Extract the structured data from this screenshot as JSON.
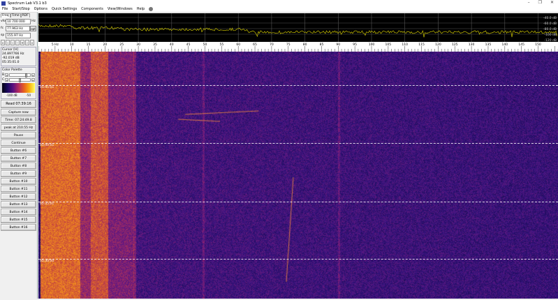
{
  "window": {
    "title": "Spectrum Lab V3.1 b3",
    "minimize": "–",
    "maximize": "❐",
    "close": "✕"
  },
  "menu": [
    "File",
    "Start/Stop",
    "Options",
    "Quick Settings",
    "Components",
    "View/Windows",
    "Help"
  ],
  "tabs": [
    "Freq",
    "Time",
    "RDF"
  ],
  "vfo": {
    "label": "vfo",
    "value": "10 700 000",
    "unit": "Hz"
  },
  "fc": {
    "label": "fc",
    "value": "77.963 Hz",
    "button": "opt"
  },
  "sp": {
    "label": "sp",
    "value": "155.97 Hz"
  },
  "arrow_buttons": [
    "«",
    "‹",
    "‹",
    "-",
    "+",
    "›",
    "»"
  ],
  "cursor": {
    "title": "Cursor [H]",
    "freq": "24.897766 Hz",
    "level": "-92.019 dB",
    "time": "05:35:01.0"
  },
  "palette": {
    "title": "Color Palette",
    "b_label": "B",
    "c_label": "C",
    "scale_min": "-100 dB",
    "scale_max": "-50",
    "b_level": 0.75,
    "c_level": 0.45
  },
  "buttons": {
    "read": "Read 07:39:16",
    "capture": "Capture now",
    "time": "Time:  07:24:49.8",
    "peak": "peak at 210.55 Hz",
    "pause": "Pause",
    "continue": "Continue",
    "numbered": [
      "Button #6",
      "Button #7",
      "Button #8",
      "Button #9",
      "Button #10",
      "Button #11",
      "Button #12",
      "Button #13",
      "Button #14",
      "Button #15",
      "Button #16"
    ]
  },
  "spectrum": {
    "db_labels": [
      "-40.0 dB",
      "-60.0 dB",
      "-80.0 dB",
      "-100 dB",
      "-120 dB"
    ],
    "trace_color": "#c8c000"
  },
  "freq_axis": {
    "labels": [
      "5 Hz",
      "10",
      "15",
      "20",
      "25",
      "30",
      "35",
      "40",
      "45",
      "50",
      "55",
      "60",
      "65",
      "70",
      "75",
      "80",
      "85",
      "90",
      "95",
      "100",
      "105",
      "110",
      "115",
      "120",
      "125",
      "130",
      "135",
      "140",
      "145",
      "150"
    ]
  },
  "waterfall": {
    "timestamps": [
      "05:45:01",
      "05:40:01",
      "05:35:01",
      "05:30:00"
    ]
  }
}
